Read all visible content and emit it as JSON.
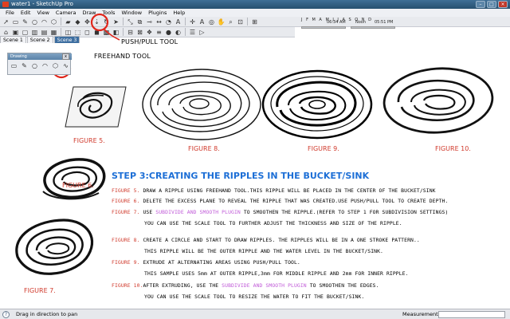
{
  "window": {
    "title": "water1 - SketchUp Pro",
    "minimize": "–",
    "maximize": "□",
    "close": "×"
  },
  "menu": [
    "File",
    "Edit",
    "View",
    "Camera",
    "Draw",
    "Tools",
    "Window",
    "Plugins",
    "Help"
  ],
  "toolbar1": [
    {
      "icon": "arrow-select-icon",
      "glyph": "➚"
    },
    {
      "icon": "rectangle-icon",
      "glyph": "▭"
    },
    {
      "icon": "line-pencil-icon",
      "glyph": "✎"
    },
    {
      "icon": "circle-icon",
      "glyph": "○"
    },
    {
      "icon": "arc-icon",
      "glyph": "◠"
    },
    {
      "icon": "polygon-icon",
      "glyph": "⬡"
    },
    {
      "icon": "eraser-icon",
      "glyph": "▰"
    },
    {
      "icon": "paint-bucket-icon",
      "glyph": "◆"
    },
    {
      "icon": "move-icon",
      "glyph": "✥"
    },
    {
      "icon": "push-pull-icon",
      "glyph": "⇣"
    },
    {
      "icon": "rotate-icon",
      "glyph": "↻"
    },
    {
      "icon": "follow-me-icon",
      "glyph": "➤"
    },
    {
      "icon": "scale-icon",
      "glyph": "⤡"
    },
    {
      "icon": "offset-icon",
      "glyph": "⧉"
    },
    {
      "icon": "tape-measure-icon",
      "glyph": "⊸"
    },
    {
      "icon": "dimension-icon",
      "glyph": "↔"
    },
    {
      "icon": "protractor-icon",
      "glyph": "◔"
    },
    {
      "icon": "text-icon",
      "glyph": "A"
    },
    {
      "icon": "axes-icon",
      "glyph": "✛"
    },
    {
      "icon": "3d-text-icon",
      "glyph": "A"
    },
    {
      "icon": "orbit-icon",
      "glyph": "◎"
    },
    {
      "icon": "pan-icon",
      "glyph": "✋"
    },
    {
      "icon": "zoom-icon",
      "glyph": "⌕"
    },
    {
      "icon": "zoom-window-icon",
      "glyph": "⊡"
    },
    {
      "icon": "zoom-extents-icon",
      "glyph": "⊞"
    }
  ],
  "toolbar2": [
    {
      "icon": "iso-view-icon",
      "glyph": "⌂"
    },
    {
      "icon": "top-view-icon",
      "glyph": "▣"
    },
    {
      "icon": "front-view-icon",
      "glyph": "▢"
    },
    {
      "icon": "right-view-icon",
      "glyph": "▥"
    },
    {
      "icon": "back-view-icon",
      "glyph": "▤"
    },
    {
      "icon": "left-view-icon",
      "glyph": "▦"
    },
    {
      "icon": "xray-icon",
      "glyph": "◫"
    },
    {
      "icon": "wireframe-icon",
      "glyph": "⬚"
    },
    {
      "icon": "hidden-line-icon",
      "glyph": "◻"
    },
    {
      "icon": "shaded-icon",
      "glyph": "◼"
    },
    {
      "icon": "shaded-texture-icon",
      "glyph": "▩"
    },
    {
      "icon": "monochrome-icon",
      "glyph": "◧"
    },
    {
      "icon": "section-plane-icon",
      "glyph": "⊟"
    },
    {
      "icon": "section-cut-icon",
      "glyph": "⊠"
    },
    {
      "icon": "components-icon",
      "glyph": "❖"
    },
    {
      "icon": "layers-icon",
      "glyph": "≡"
    },
    {
      "icon": "materials-icon",
      "glyph": "●"
    },
    {
      "icon": "styles-icon",
      "glyph": "◐"
    },
    {
      "icon": "outliner-icon",
      "glyph": "☰"
    },
    {
      "icon": "scenes-icon",
      "glyph": "▷"
    }
  ],
  "shadow": {
    "months": "J F M A M J J A S O N D",
    "time1": "06:34 AM",
    "noon": "Noon",
    "time2": "05:51 PM"
  },
  "tabs": [
    "Scene 1",
    "Scene 2",
    "Scene 3"
  ],
  "active_tab_index": 2,
  "annotations": {
    "push_pull": "PUSH/PULL TOOL",
    "freehand": "FREEHAND TOOL"
  },
  "drawing_toolbar": {
    "title": "Drawing",
    "close": "x"
  },
  "figures": {
    "fig5": "FIGURE 5.",
    "fig8": "FIGURE 8.",
    "fig9": "FIGURE 9.",
    "fig10": "FIGURE 10.",
    "fig6": "FIGURE 6.",
    "fig7": "FIGURE 7."
  },
  "step_title": "STEP 3:CREATING THE RIPPLES IN THE BUCKET/SINK",
  "instructions": [
    {
      "ref": "FIGURE 5.",
      "text": " DRAW A RIPPLE USING FREEHAND TOOL.THIS RIPPLE WILL BE PLACED IN THE CENTER OF THE BUCKET/SINK"
    },
    {
      "ref": "FIGURE 6.",
      "text": " DELETE THE EXCESS PLANE TO REVEAL THE RIPPLE THAT WAS CREATED.USE PUSH/PULL TOOL TO CREATE DEPTH."
    },
    {
      "ref": "FIGURE 7.",
      "pre": " USE ",
      "hl": "SUBDIVIDE AND SMOOTH PLUGIN",
      "text": " TO SMOOTHEN THE RIPPLE.(REFER TO STEP 1 FOR SUBDIVISION SETTINGS)"
    },
    {
      "cont": "YOU CAN USE THE SCALE TOOL TO FURTHER ADJUST THE THICKNESS AND SIZE OF THE RIPPLE."
    },
    {
      "ref": "FIGURE 8.",
      "text": " CREATE A CIRCLE AND START TO DRAW RIPPLES. THE RIPPLES WILL BE IN A ONE STROKE PATTERN.."
    },
    {
      "cont": "THIS RIPPLE WILL BE THE OUTER RIPPLE AND THE WATER LEVEL IN THE BUCKET/SINK."
    },
    {
      "ref": "FIGURE 9.",
      "text": " EXTRUDE AT ALTERNATING AREAS USING PUSH/PULL TOOL."
    },
    {
      "cont": "THIS SAMPLE USES 5mm AT OUTER RIPPLE,3mm FOR MIDDLE RIPPLE AND 2mm FOR INNER RIPPLE."
    },
    {
      "ref": "FIGURE 10.",
      "pre": "AFTER EXTRUDING, USE THE ",
      "hl": "SUBDIVIDE AND SMOOTH PLUGIN",
      "text": " TO SMOOTHEN THE EDGES."
    },
    {
      "cont": "YOU CAN USE THE SCALE TOOL TO RESIZE THE WATER TO FIT THE BUCKET/SINK."
    }
  ],
  "status": {
    "hint": "Drag in direction to pan",
    "measurements_label": "Measurements",
    "measurements_value": ""
  },
  "colors": {
    "highlight_red": "#e0261b",
    "title_blue": "#1d6fd6",
    "figure_red": "#d03a2c",
    "plugin_purple": "#c05ad8"
  }
}
